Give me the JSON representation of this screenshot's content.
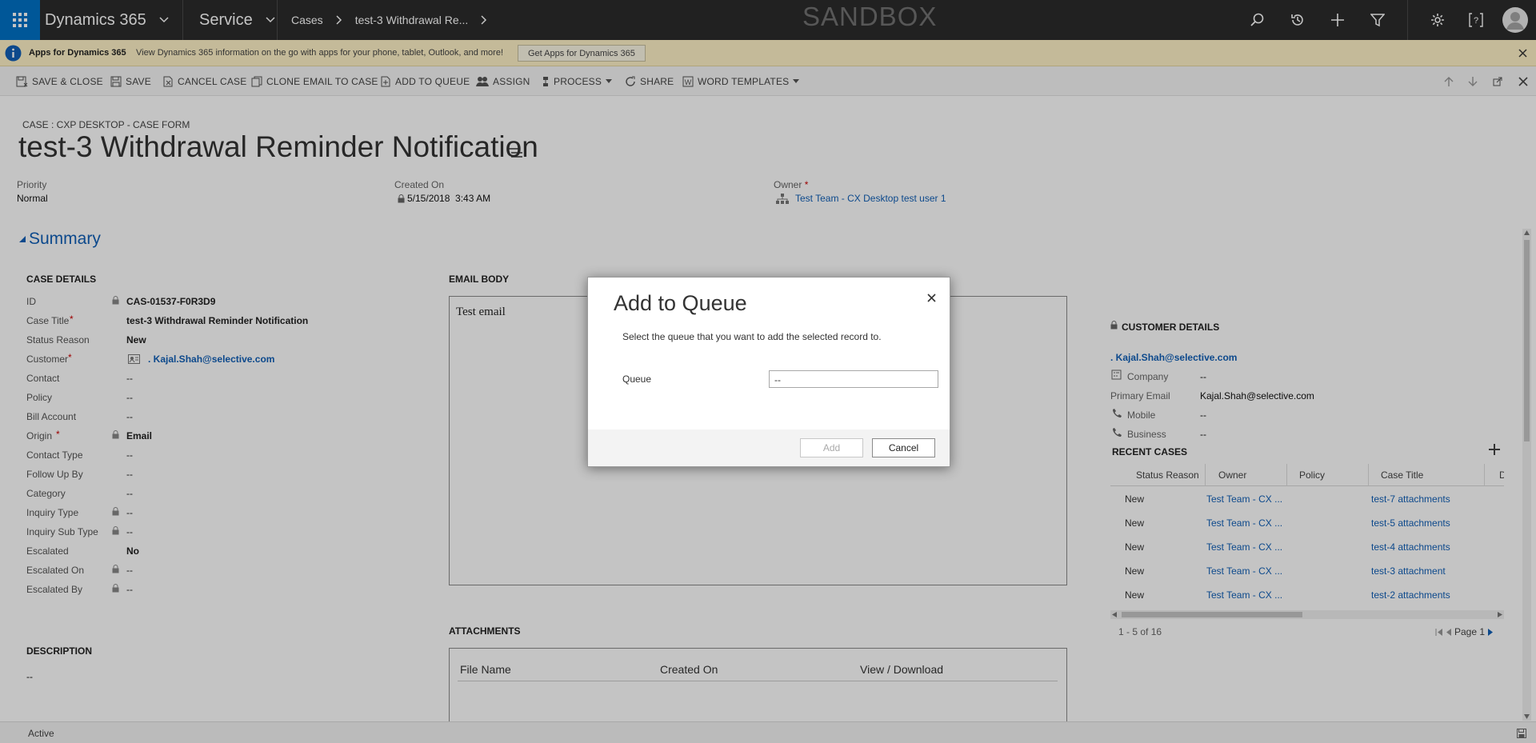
{
  "nav": {
    "app_name": "Dynamics 365",
    "area": "Service",
    "breadcrumb_1": "Cases",
    "breadcrumb_2": "test-3 Withdrawal Re...",
    "environment": "SANDBOX"
  },
  "notification": {
    "title": "Apps for Dynamics 365",
    "message": "View Dynamics 365 information on the go with apps for your phone, tablet, Outlook, and more!",
    "button": "Get Apps for Dynamics 365"
  },
  "commands": {
    "save_close": "SAVE & CLOSE",
    "save": "SAVE",
    "cancel_case": "CANCEL CASE",
    "clone_email": "CLONE EMAIL TO CASE",
    "add_to_queue": "ADD TO QUEUE",
    "assign": "ASSIGN",
    "process": "PROCESS",
    "share": "SHARE",
    "word_templates": "WORD TEMPLATES"
  },
  "form": {
    "entity_label": "CASE : CXP DESKTOP - CASE FORM",
    "title": "test-3 Withdrawal Reminder Notification",
    "priority_label": "Priority",
    "priority_value": "Normal",
    "created_on_label": "Created On",
    "created_on_value": "5/15/2018  3:43 AM",
    "owner_label": "Owner",
    "owner_value": "Test Team - CX Desktop test user 1",
    "summary": "Summary"
  },
  "case_details": {
    "heading": "CASE DETAILS",
    "fields": [
      {
        "label": "ID",
        "value": "CAS-01537-F0R3D9"
      },
      {
        "label": "Case Title",
        "value": "test-3 Withdrawal Reminder Notification"
      },
      {
        "label": "Status Reason",
        "value": "New"
      },
      {
        "label": "Customer",
        "value": ". Kajal.Shah@selective.com"
      },
      {
        "label": "Contact",
        "value": "--"
      },
      {
        "label": "Policy",
        "value": "--"
      },
      {
        "label": "Bill Account",
        "value": "--"
      },
      {
        "label": "Origin",
        "value": "Email"
      },
      {
        "label": "Contact Type",
        "value": "--"
      },
      {
        "label": "Follow Up By",
        "value": "--"
      },
      {
        "label": "Category",
        "value": "--"
      },
      {
        "label": "Inquiry Type",
        "value": "--"
      },
      {
        "label": "Inquiry Sub Type",
        "value": "--"
      },
      {
        "label": "Escalated",
        "value": "No"
      },
      {
        "label": "Escalated On",
        "value": "--"
      },
      {
        "label": "Escalated By",
        "value": "--"
      }
    ]
  },
  "description": {
    "heading": "DESCRIPTION",
    "value": "--"
  },
  "email_body": {
    "heading": "EMAIL BODY",
    "text": "Test email"
  },
  "attachments": {
    "heading": "ATTACHMENTS",
    "columns": [
      "File Name",
      "Created On",
      "View / Download"
    ]
  },
  "customer_details": {
    "heading": "CUSTOMER DETAILS",
    "name": ". Kajal.Shah@selective.com",
    "company_label": "Company",
    "company_value": "--",
    "email_label": "Primary Email",
    "email_value": "Kajal.Shah@selective.com",
    "mobile_label": "Mobile",
    "mobile_value": "--",
    "business_label": "Business",
    "business_value": "--"
  },
  "recent_cases": {
    "heading": "RECENT CASES",
    "columns": [
      "Status Reason",
      "Owner",
      "Policy",
      "Case Title",
      "D"
    ],
    "rows": [
      {
        "status": "New",
        "owner": "Test Team - CX ...",
        "policy": "",
        "title": "test-7 attachments"
      },
      {
        "status": "New",
        "owner": "Test Team - CX ...",
        "policy": "",
        "title": "test-5 attachments"
      },
      {
        "status": "New",
        "owner": "Test Team - CX ...",
        "policy": "",
        "title": "test-4 attachments"
      },
      {
        "status": "New",
        "owner": "Test Team - CX ...",
        "policy": "",
        "title": "test-3 attachment"
      },
      {
        "status": "New",
        "owner": "Test Team - CX ...",
        "policy": "",
        "title": "test-2 attachments"
      }
    ],
    "count": "1 - 5 of 16",
    "page": "Page 1"
  },
  "dialog": {
    "title": "Add to Queue",
    "instruction": "Select the queue that you want to add the selected record to.",
    "queue_label": "Queue",
    "queue_value": "--",
    "add_button": "Add",
    "cancel_button": "Cancel"
  },
  "status": {
    "value": "Active"
  },
  "colors": {
    "nav_bg": "#2b2b2b",
    "waffle_bg": "#0072c6",
    "link": "#1160b7",
    "notification_bg": "#fff3c7"
  }
}
